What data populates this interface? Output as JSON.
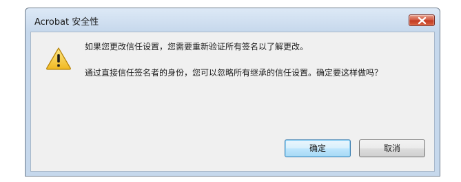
{
  "dialog": {
    "title": "Acrobat 安全性",
    "message_1": "如果您更改信任设置，您需要重新验证所有签名以了解更改。",
    "message_2": "通过直接信任签名者的身份，您可以忽略所有继承的信任设置。确定要这样做吗？",
    "icon": "warning-icon",
    "close_icon": "close-icon",
    "ok_label": "确定",
    "cancel_label": "取消"
  },
  "colors": {
    "frame": "#c6d8ec",
    "client": "#f0f0f0",
    "close_red": "#c23a23",
    "default_button": "#3c7fb1",
    "warning_yellow": "#f5c93b"
  }
}
